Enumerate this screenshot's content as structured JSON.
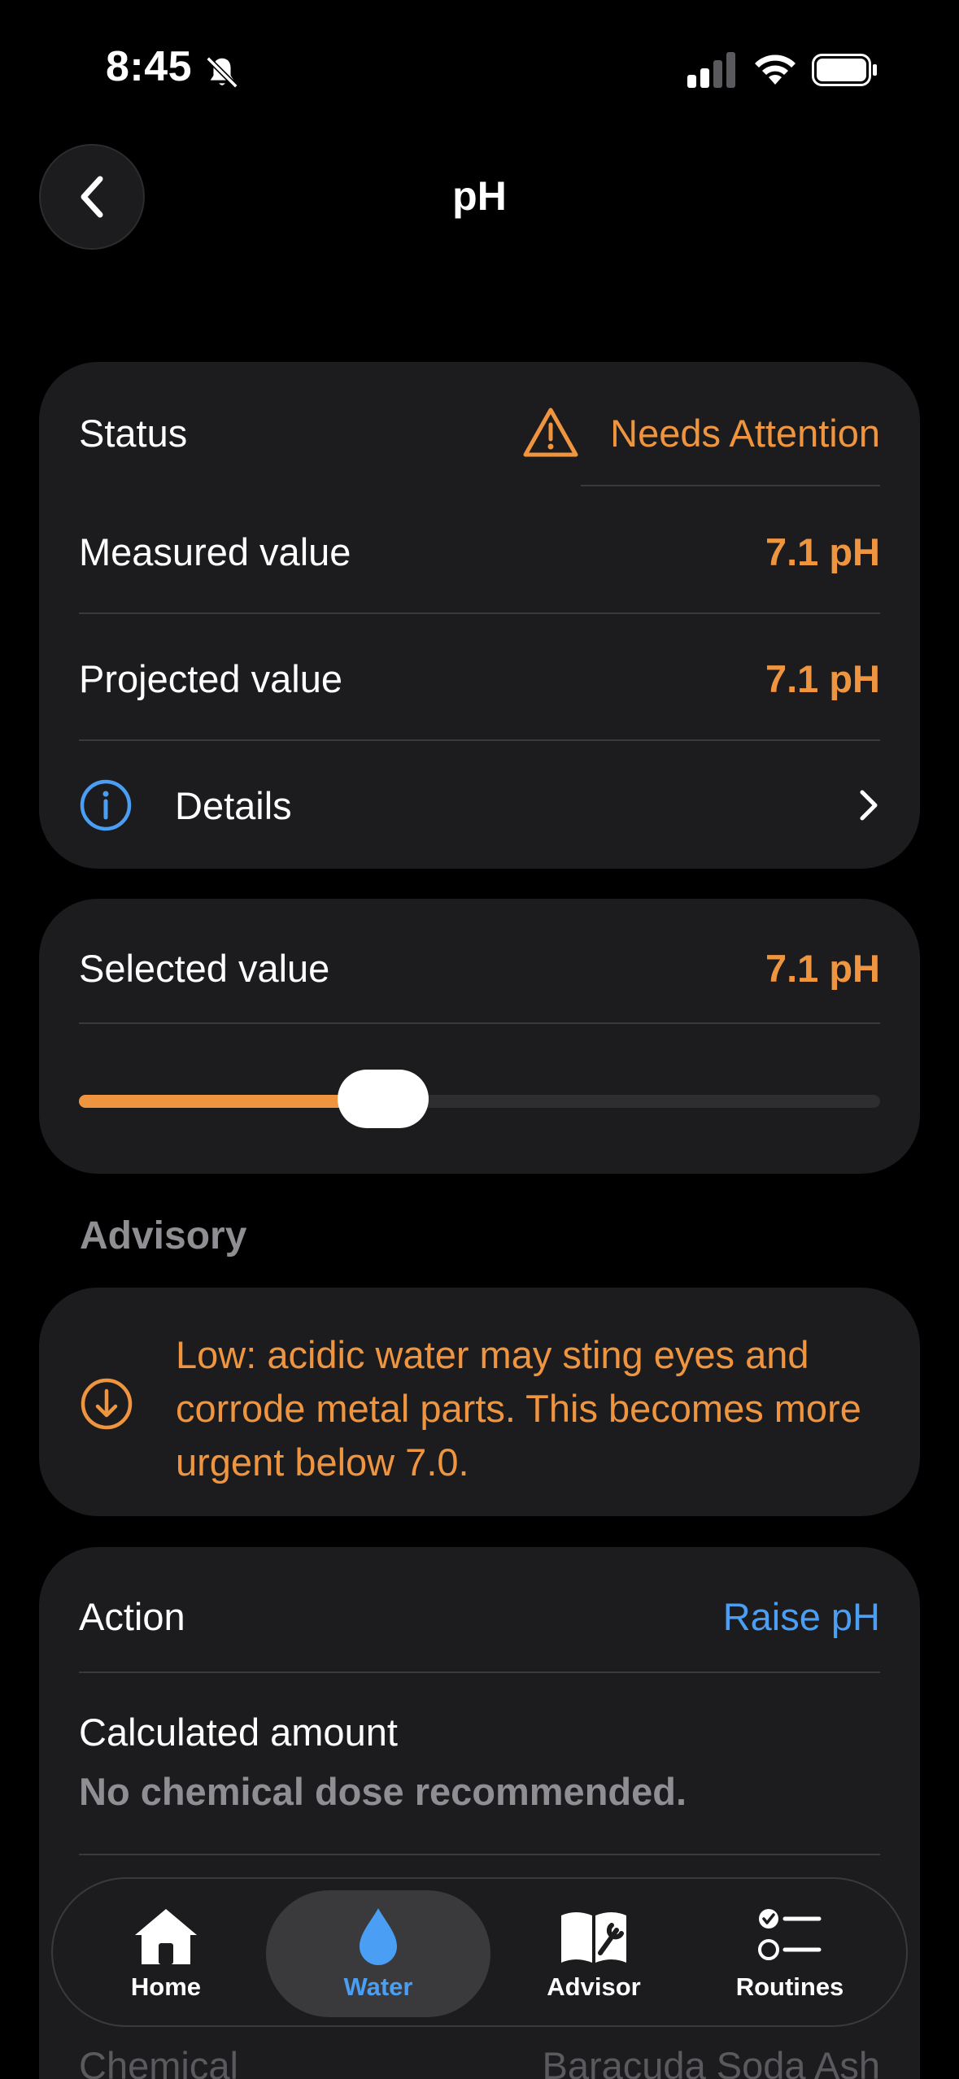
{
  "status_bar": {
    "time": "8:45"
  },
  "header": {
    "title": "pH"
  },
  "status_card": {
    "status_label": "Status",
    "status_value": "Needs Attention",
    "measured_label": "Measured value",
    "measured_value": "7.1 pH",
    "projected_label": "Projected value",
    "projected_value": "7.1 pH",
    "details_label": "Details"
  },
  "selected_card": {
    "label": "Selected value",
    "value": "7.1 pH",
    "slider_fraction": 0.38
  },
  "advisory": {
    "section_label": "Advisory",
    "text": "Low: acidic water may sting eyes and corrode metal parts. This becomes more urgent below 7.0."
  },
  "action_card": {
    "action_label": "Action",
    "action_value": "Raise pH",
    "calculated_label": "Calculated amount",
    "calculated_value": "No chemical dose recommended.",
    "chemical_label": "Chemical",
    "chemical_value": "Baracuda Soda Ash"
  },
  "tab_bar": {
    "items": [
      {
        "label": "Home",
        "icon": "house-icon"
      },
      {
        "label": "Water",
        "icon": "droplet-icon"
      },
      {
        "label": "Advisor",
        "icon": "book-wrench-icon"
      },
      {
        "label": "Routines",
        "icon": "checklist-icon"
      }
    ],
    "active": "Water"
  },
  "colors": {
    "accent_orange": "#f0953f",
    "accent_blue": "#4a9ff5",
    "card_bg": "#1c1c1e",
    "muted_text": "#8e8e93"
  }
}
